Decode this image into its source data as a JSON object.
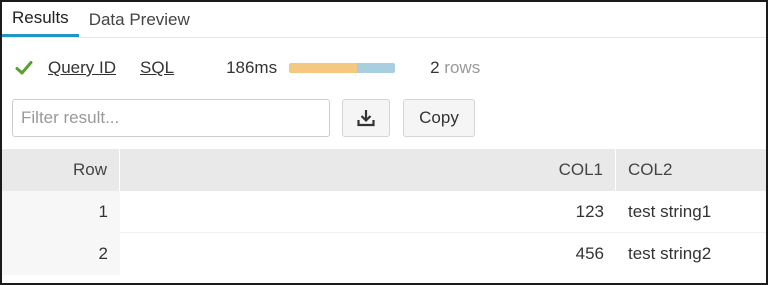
{
  "tabs": [
    {
      "label": "Results",
      "active": true
    },
    {
      "label": "Data Preview",
      "active": false
    }
  ],
  "status": {
    "icon": "check-icon",
    "color": "#5aa02c",
    "query_id_label": "Query ID",
    "sql_label": "SQL",
    "duration": "186ms",
    "rows_number": "2",
    "rows_word": "rows",
    "timing_bar": {
      "segment_a_fraction": 0.64,
      "segment_b_fraction": 0.36,
      "color_a": "#f5c882",
      "color_b": "#a7cfe0"
    }
  },
  "toolbar": {
    "filter_placeholder": "Filter result...",
    "filter_value": "",
    "download_icon": "download-icon",
    "copy_label": "Copy"
  },
  "table": {
    "columns": [
      "Row",
      "COL1",
      "COL2"
    ],
    "rows": [
      [
        "1",
        "123",
        "test string1"
      ],
      [
        "2",
        "456",
        "test string2"
      ]
    ]
  },
  "accent_color": "#2196c4"
}
